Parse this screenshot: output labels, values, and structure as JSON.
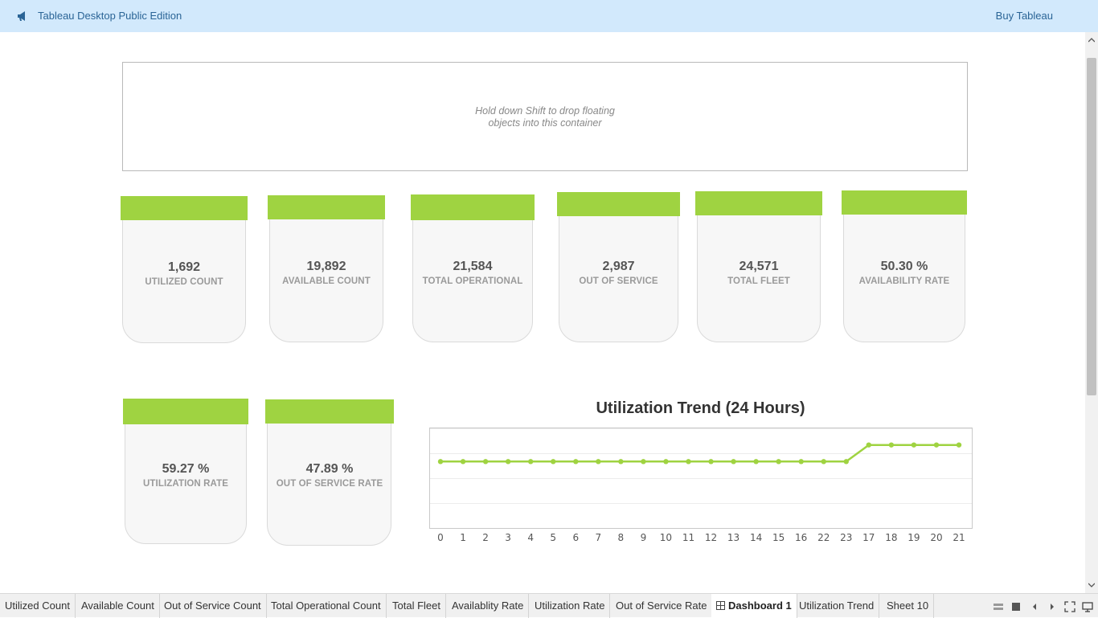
{
  "topbar": {
    "icon": "megaphone-icon",
    "title": "Tableau Desktop Public Edition",
    "buy_label": "Buy Tableau"
  },
  "container": {
    "hint_line1": "Hold down Shift to drop floating",
    "hint_line2": "objects into this container"
  },
  "colors": {
    "accent": "#9fd341",
    "topbar": "#d2e9fc",
    "link": "#2a6496"
  },
  "kpis": [
    {
      "value": "1,692",
      "label": "UTILIZED COUNT"
    },
    {
      "value": "19,892",
      "label": "AVAILABLE COUNT"
    },
    {
      "value": "21,584",
      "label": "TOTAL OPERATIONAL"
    },
    {
      "value": "2,987",
      "label": "OUT OF SERVICE"
    },
    {
      "value": "24,571",
      "label": "TOTAL FLEET"
    },
    {
      "value": "50.30 %",
      "label": "AVAILABILITY RATE"
    },
    {
      "value": "59.27 %",
      "label": "UTILIZATION RATE"
    },
    {
      "value": "47.89 %",
      "label": "OUT OF SERVICE RATE"
    }
  ],
  "chart_data": {
    "type": "line",
    "title": "Utilization Trend (24 Hours)",
    "xlabel": "",
    "ylabel": "",
    "categories": [
      "0",
      "1",
      "2",
      "3",
      "4",
      "5",
      "6",
      "7",
      "8",
      "9",
      "10",
      "11",
      "12",
      "13",
      "14",
      "15",
      "16",
      "22",
      "23",
      "17",
      "18",
      "19",
      "20",
      "21"
    ],
    "series": [
      {
        "values": [
          70,
          70,
          70,
          70,
          70,
          70,
          70,
          70,
          70,
          70,
          70,
          70,
          70,
          70,
          70,
          70,
          70,
          70,
          70,
          72,
          72,
          72,
          72,
          72
        ]
      }
    ],
    "ylim": [
      62,
      74
    ],
    "grid": true,
    "color": "#9fd341"
  },
  "tabs": [
    {
      "label": "Utilized Count"
    },
    {
      "label": "Available Count"
    },
    {
      "label": "Out of Service Count"
    },
    {
      "label": "Total Operational Count"
    },
    {
      "label": "Total Fleet"
    },
    {
      "label": "Availablity Rate"
    },
    {
      "label": "Utilization Rate"
    },
    {
      "label": "Out of Service Rate"
    },
    {
      "label": "Dashboard 1",
      "active": true
    },
    {
      "label": "Utilization Trend"
    },
    {
      "label": "Sheet 10"
    }
  ]
}
